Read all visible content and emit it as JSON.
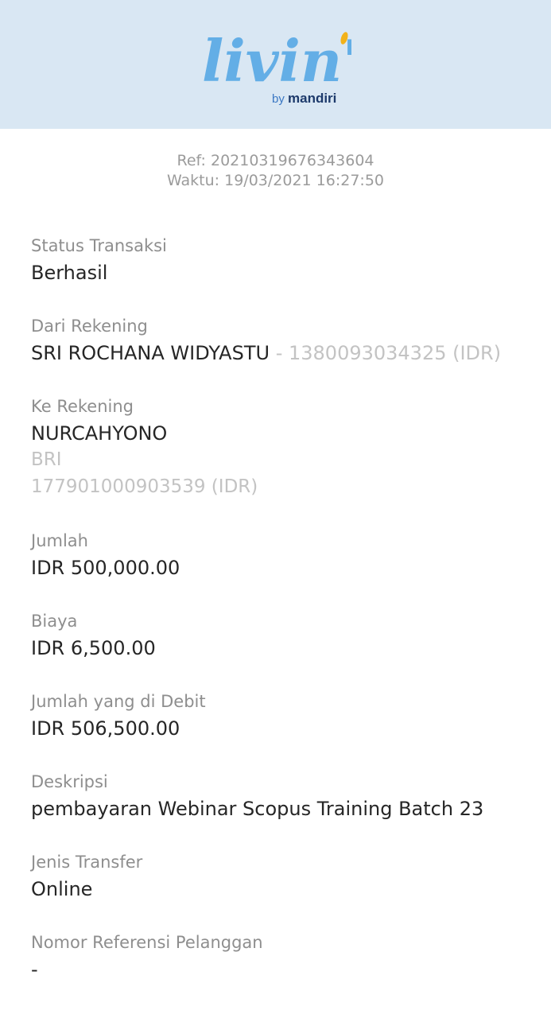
{
  "brand": {
    "logo_text": "livin'",
    "by_text": "by",
    "bank_text": "mandiri",
    "colors": {
      "header_bg": "#d9e7f3",
      "logo_blue": "#63aee6",
      "accent_yellow": "#f2b21a",
      "bank_navy": "#1d3a6b"
    }
  },
  "receipt": {
    "ref": "Ref: 20210319676343604",
    "time": "Waktu: 19/03/2021 16:27:50"
  },
  "fields": {
    "status": {
      "label": "Status Transaksi",
      "value": "Berhasil"
    },
    "from_account": {
      "label": "Dari Rekening",
      "name": "SRI ROCHANA WIDYASTU",
      "separator": " - ",
      "number": "1380093034325 (IDR)"
    },
    "to_account": {
      "label": "Ke Rekening",
      "name": "NURCAHYONO",
      "bank": "BRI",
      "number": "177901000903539 (IDR)"
    },
    "amount": {
      "label": "Jumlah",
      "value": "IDR 500,000.00"
    },
    "fee": {
      "label": "Biaya",
      "value": "IDR 6,500.00"
    },
    "debited": {
      "label": "Jumlah yang di Debit",
      "value": "IDR 506,500.00"
    },
    "description": {
      "label": "Deskripsi",
      "value": "pembayaran Webinar Scopus Training Batch 23"
    },
    "transfer_type": {
      "label": "Jenis Transfer",
      "value": "Online"
    },
    "customer_ref": {
      "label": "Nomor Referensi Pelanggan",
      "value": "-"
    }
  }
}
